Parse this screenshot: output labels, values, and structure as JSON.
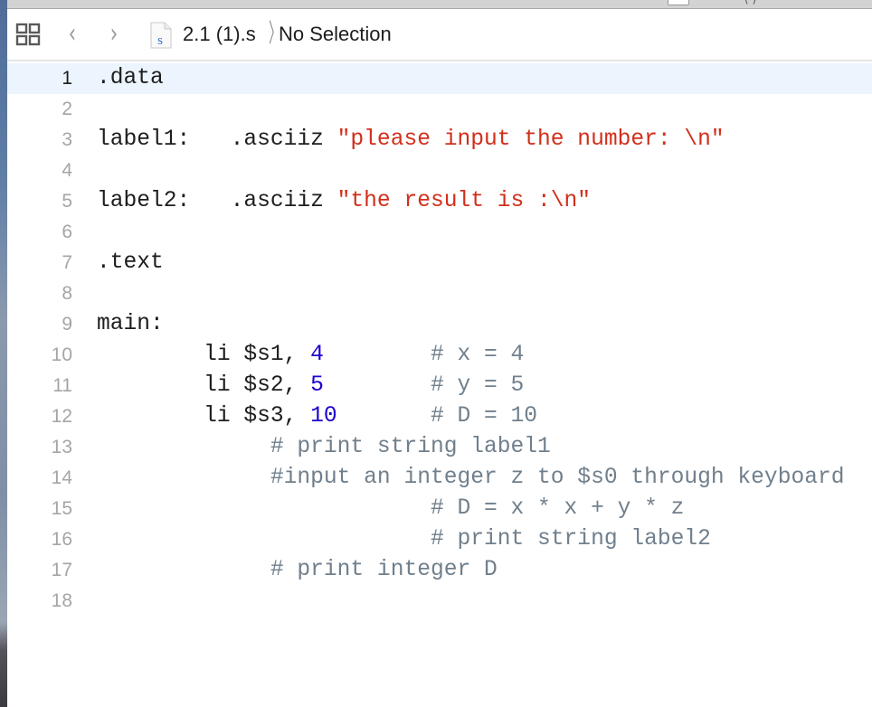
{
  "window": {
    "jumpbar": {
      "file_name": "2.1 (1).s",
      "file_icon_letter": "S",
      "separator": "〉",
      "selection": "No Selection",
      "back_glyph": "‹",
      "forward_glyph": "›"
    }
  },
  "colors": {
    "string": "#d12f1b",
    "number": "#1c00cf",
    "comment": "#707f8c",
    "plain": "#1d1d1d",
    "current_line_bg": "#ecf4fe",
    "line_number": "#a5a5a5"
  },
  "editor": {
    "current_line": 1,
    "lines": [
      {
        "n": "1",
        "tokens": [
          {
            "t": ".data",
            "k": "plain"
          }
        ]
      },
      {
        "n": "2",
        "tokens": []
      },
      {
        "n": "3",
        "tokens": [
          {
            "t": "label1:   .asciiz ",
            "k": "plain"
          },
          {
            "t": "\"please input the number: \\n\"",
            "k": "str"
          }
        ]
      },
      {
        "n": "4",
        "tokens": []
      },
      {
        "n": "5",
        "tokens": [
          {
            "t": "label2:   .asciiz ",
            "k": "plain"
          },
          {
            "t": "\"the result is :\\n\"",
            "k": "str"
          }
        ]
      },
      {
        "n": "6",
        "tokens": []
      },
      {
        "n": "7",
        "tokens": [
          {
            "t": ".text",
            "k": "plain"
          }
        ]
      },
      {
        "n": "8",
        "tokens": []
      },
      {
        "n": "9",
        "tokens": [
          {
            "t": "main:",
            "k": "plain"
          }
        ]
      },
      {
        "n": "10",
        "tokens": [
          {
            "t": "        li $s1, ",
            "k": "plain"
          },
          {
            "t": "4",
            "k": "num"
          },
          {
            "t": "        # x = 4",
            "k": "cmt"
          }
        ]
      },
      {
        "n": "11",
        "tokens": [
          {
            "t": "        li $s2, ",
            "k": "plain"
          },
          {
            "t": "5",
            "k": "num"
          },
          {
            "t": "        # y = 5",
            "k": "cmt"
          }
        ]
      },
      {
        "n": "12",
        "tokens": [
          {
            "t": "        li $s3, ",
            "k": "plain"
          },
          {
            "t": "10",
            "k": "num"
          },
          {
            "t": "       # D = 10",
            "k": "cmt"
          }
        ]
      },
      {
        "n": "13",
        "tokens": [
          {
            "t": "             # print string label1",
            "k": "cmt"
          }
        ]
      },
      {
        "n": "14",
        "tokens": [
          {
            "t": "             #input an integer z to $s0 through keyboard",
            "k": "cmt"
          }
        ]
      },
      {
        "n": "15",
        "tokens": [
          {
            "t": "                         # D = x * x + y * z",
            "k": "cmt"
          }
        ]
      },
      {
        "n": "16",
        "tokens": [
          {
            "t": "                         # print string label2",
            "k": "cmt"
          }
        ]
      },
      {
        "n": "17",
        "tokens": [
          {
            "t": "             # print integer D",
            "k": "cmt"
          }
        ]
      },
      {
        "n": "18",
        "tokens": []
      }
    ]
  }
}
